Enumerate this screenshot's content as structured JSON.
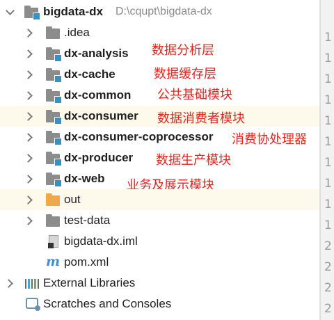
{
  "project": {
    "name": "bigdata-dx",
    "path": "D:\\cqupt\\bigdata-dx"
  },
  "tree": [
    {
      "label": ".idea",
      "note": ""
    },
    {
      "label": "dx-analysis",
      "note": "数据分析层"
    },
    {
      "label": "dx-cache",
      "note": "数据缓存层"
    },
    {
      "label": "dx-common",
      "note": "公共基础模块"
    },
    {
      "label": "dx-consumer",
      "note": "数据消费者模块"
    },
    {
      "label": "dx-consumer-coprocessor",
      "note": "消费协处理器"
    },
    {
      "label": "dx-producer",
      "note": "数据生产模块"
    },
    {
      "label": "dx-web",
      "note": "业务及展示模块"
    },
    {
      "label": "out",
      "note": ""
    },
    {
      "label": "test-data",
      "note": ""
    },
    {
      "label": "bigdata-dx.iml",
      "note": ""
    },
    {
      "label": "pom.xml",
      "note": ""
    }
  ],
  "external_libraries": "External Libraries",
  "scratches": "Scratches and Consoles",
  "gutter": [
    "1",
    "1",
    "1",
    "1",
    "1",
    "1",
    "1",
    "1",
    "1",
    "1",
    "2",
    "2",
    "2",
    "2",
    "2"
  ],
  "colors": {
    "annotation": "#e8231e",
    "module_badge": "#3592c4",
    "folder_excluded": "#f0a94a",
    "selected_row": "#fdfaeb"
  }
}
